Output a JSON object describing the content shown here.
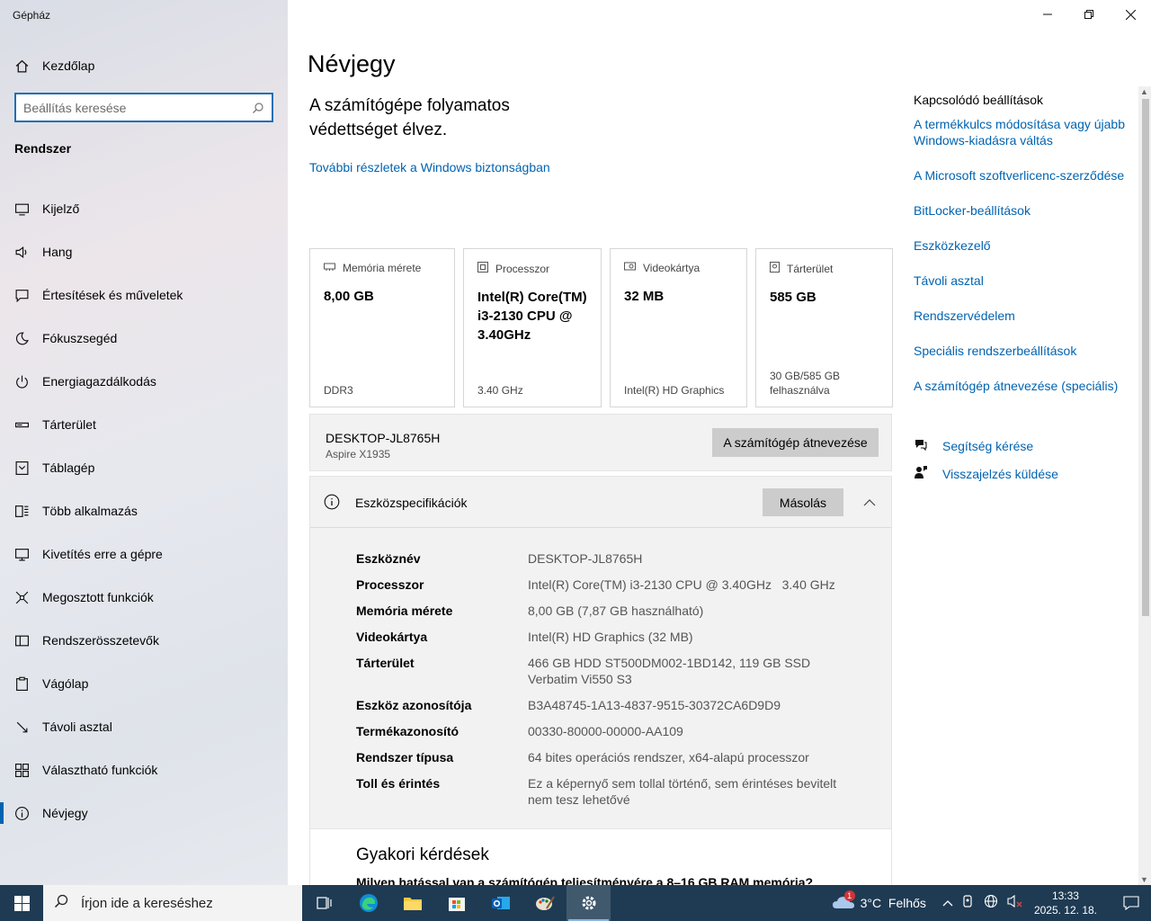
{
  "app": {
    "title": "Gépház"
  },
  "sidebar": {
    "home_label": "Kezdőlap",
    "search_placeholder": "Beállítás keresése",
    "section": "Rendszer",
    "items": [
      {
        "label": "Kijelző",
        "icon": "monitor-icon"
      },
      {
        "label": "Hang",
        "icon": "speaker-icon"
      },
      {
        "label": "Értesítések és műveletek",
        "icon": "notification-icon"
      },
      {
        "label": "Fókuszsegéd",
        "icon": "moon-icon"
      },
      {
        "label": "Energiagazdálkodás",
        "icon": "power-icon"
      },
      {
        "label": "Tárterület",
        "icon": "storage-icon"
      },
      {
        "label": "Táblagép",
        "icon": "tablet-icon"
      },
      {
        "label": "Több alkalmazás",
        "icon": "multitask-icon"
      },
      {
        "label": "Kivetítés erre a gépre",
        "icon": "project-icon"
      },
      {
        "label": "Megosztott funkciók",
        "icon": "share-icon"
      },
      {
        "label": "Rendszerösszetevők",
        "icon": "components-icon"
      },
      {
        "label": "Vágólap",
        "icon": "clipboard-icon"
      },
      {
        "label": "Távoli asztal",
        "icon": "remote-icon"
      },
      {
        "label": "Választható funkciók",
        "icon": "apps-icon"
      },
      {
        "label": "Névjegy",
        "icon": "info-icon",
        "active": true
      }
    ]
  },
  "main": {
    "title": "Névjegy",
    "protection": "A számítógépe folyamatos védettséget élvez.",
    "security_link": "További részletek a Windows biztonságban",
    "cards": [
      {
        "title": "Memória mérete",
        "value": "8,00 GB",
        "sub": "DDR3",
        "icon": "memory-icon"
      },
      {
        "title": "Processzor",
        "value": "Intel(R) Core(TM) i3-2130 CPU @ 3.40GHz",
        "sub": "3.40 GHz",
        "icon": "cpu-icon"
      },
      {
        "title": "Videokártya",
        "value": "32 MB",
        "sub": "Intel(R) HD Graphics",
        "icon": "gpu-icon"
      },
      {
        "title": "Tárterület",
        "value": "585 GB",
        "sub": "30 GB/585 GB felhasználva",
        "icon": "disk-icon"
      }
    ],
    "device": {
      "name": "DESKTOP-JL8765H",
      "model": "Aspire X1935",
      "rename_button": "A számítógép átnevezése"
    },
    "specs": {
      "title": "Eszközspecifikációk",
      "copy_button": "Másolás",
      "rows": [
        {
          "k": "Eszköznév",
          "v": "DESKTOP-JL8765H"
        },
        {
          "k": "Processzor",
          "v": "Intel(R) Core(TM) i3-2130 CPU @ 3.40GHz   3.40 GHz"
        },
        {
          "k": "Memória mérete",
          "v": "8,00 GB (7,87 GB használható)"
        },
        {
          "k": "Videokártya",
          "v": "Intel(R) HD Graphics (32 MB)"
        },
        {
          "k": "Tárterület",
          "v": "466 GB HDD ST500DM002-1BD142, 119 GB SSD Verbatim Vi550 S3"
        },
        {
          "k": "Eszköz azonosítója",
          "v": "B3A48745-1A13-4837-9515-30372CA6D9D9"
        },
        {
          "k": "Termékazonosító",
          "v": "00330-80000-00000-AA109"
        },
        {
          "k": "Rendszer típusa",
          "v": "64 bites operációs rendszer, x64-alapú processzor"
        },
        {
          "k": "Toll és érintés",
          "v": "Ez a képernyő sem tollal történő, sem érintéses bevitelt nem tesz lehetővé"
        }
      ]
    },
    "faq": {
      "title": "Gyakori kérdések",
      "question": "Milyen hatással van a számítógép teljesítményére a 8–16 GB RAM memória?"
    }
  },
  "related": {
    "title": "Kapcsolódó beállítások",
    "links": [
      "A termékkulcs módosítása vagy újabb Windows-kiadásra váltás",
      "A Microsoft szoftverlicenc-szerződése",
      "BitLocker-beállítások",
      "Eszközkezelő",
      "Távoli asztal",
      "Rendszervédelem",
      "Speciális rendszerbeállítások",
      "A számítógép átnevezése (speciális)"
    ],
    "help": "Segítség kérése",
    "feedback": "Visszajelzés küldése"
  },
  "taskbar": {
    "search_placeholder": "Írjon ide a kereséshez",
    "weather": "3°C  Felhős",
    "weather_badge": "1",
    "time": "13:33",
    "date": "2025. 12. 18.",
    "accent": "#1f3b53"
  }
}
